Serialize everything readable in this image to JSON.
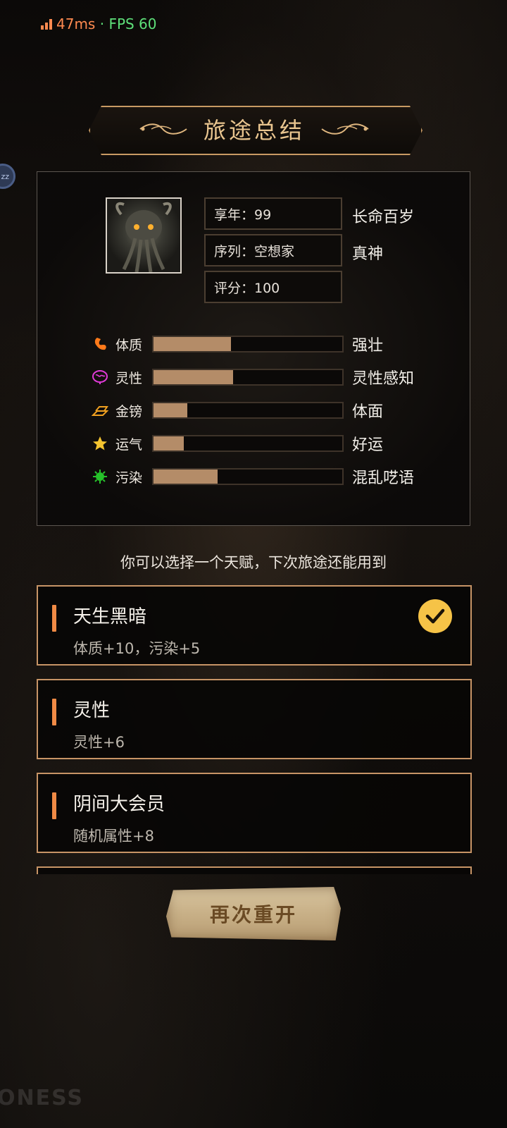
{
  "status": {
    "ping": "47ms",
    "separator": " · ",
    "fps": "FPS 60"
  },
  "side_bubble": {
    "text": "zz"
  },
  "header": {
    "title": "旅途总结"
  },
  "summary": {
    "info": [
      {
        "text": "享年：99",
        "title": "长命百岁"
      },
      {
        "text": "序列：空想家",
        "title": "真神"
      },
      {
        "text": "评分：100",
        "title": ""
      }
    ],
    "attributes": [
      {
        "label": "体质",
        "icon": "muscle-icon",
        "fraction": 0.41,
        "value": "强壮",
        "color": "#ff7a1a"
      },
      {
        "label": "灵性",
        "icon": "brain-icon",
        "fraction": 0.42,
        "value": "灵性感知",
        "color": "#e03ad8"
      },
      {
        "label": "金镑",
        "icon": "gold-bars-icon",
        "fraction": 0.18,
        "value": "体面",
        "color": "#f0a020"
      },
      {
        "label": "运气",
        "icon": "star-icon",
        "fraction": 0.16,
        "value": "好运",
        "color": "#f4c430"
      },
      {
        "label": "污染",
        "icon": "virus-icon",
        "fraction": 0.34,
        "value": "混乱呓语",
        "color": "#26c22a"
      }
    ]
  },
  "hint": "你可以选择一个天赋，下次旅途还能用到",
  "talents": [
    {
      "name": "天生黑暗",
      "desc": "体质+10，污染+5",
      "selected": true
    },
    {
      "name": "灵性",
      "desc": "灵性+6",
      "selected": false
    },
    {
      "name": "阴间大会员",
      "desc": "随机属性+8",
      "selected": false
    }
  ],
  "restart_label": "再次重开",
  "watermark": "ONESS",
  "colors": {
    "accent": "#f08a45",
    "border": "#c79466",
    "title": "#e9c58f",
    "bar_fill": "#b48c68",
    "check": "#f6c347"
  }
}
